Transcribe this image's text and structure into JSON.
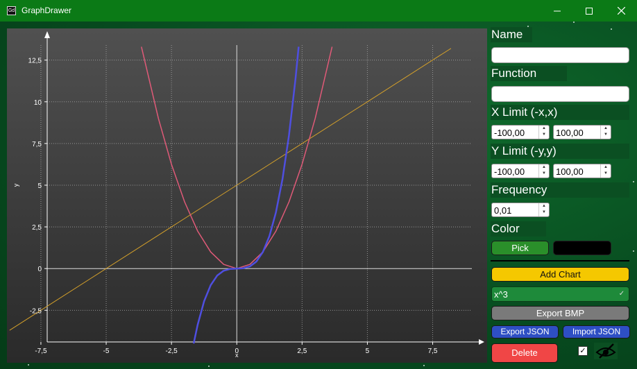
{
  "window": {
    "title": "GraphDrawer",
    "app_icon_text": "Gd"
  },
  "panel": {
    "name_label": "Name",
    "name_value": "",
    "function_label": "Function",
    "function_value": "",
    "xlimit_label": "X Limit (-x,x)",
    "xlimit_min": "-100,00",
    "xlimit_max": "100,00",
    "ylimit_label": "Y Limit (-y,y)",
    "ylimit_min": "-100,00",
    "ylimit_max": "100,00",
    "frequency_label": "Frequency",
    "frequency_value": "0,01",
    "color_label": "Color",
    "pick_label": "Pick",
    "color_swatch": "#000000",
    "add_chart_label": "Add Chart",
    "selected_chart": "x^3",
    "export_bmp_label": "Export BMP",
    "export_json_label": "Export JSON",
    "import_json_label": "Import JSON",
    "delete_label": "Delete",
    "visible_checked": true
  },
  "colors": {
    "titlebar": "#0b7a16",
    "add_chart": "#f5c800",
    "pick": "#2a8f2a",
    "export_bmp": "#7a7a7a",
    "json_buttons": "#2e4fc4",
    "delete": "#f04646"
  },
  "chart_data": {
    "type": "line",
    "xlabel": "x",
    "ylabel": "y",
    "xlim": [
      -8.8,
      9.0
    ],
    "ylim": [
      -4.4,
      13.4
    ],
    "x_ticks": [
      "-7,5",
      "-5",
      "-2,5",
      "0",
      "2,5",
      "5",
      "7,5"
    ],
    "y_ticks": [
      "-2,5",
      "0",
      "2,5",
      "5",
      "7,5",
      "10",
      "12,5"
    ],
    "grid": true,
    "series": [
      {
        "formula": "x+5",
        "color": "#d4a02a",
        "width": 1,
        "x": [
          -8.7,
          -7.5,
          -5,
          -2.5,
          0,
          2.5,
          5,
          7.5,
          8.2
        ],
        "y": [
          -3.7,
          -2.5,
          0,
          2.5,
          5,
          7.5,
          10,
          12.5,
          13.2
        ]
      },
      {
        "formula": "x^2",
        "color": "#e05a78",
        "width": 1.5,
        "x": [
          -3.65,
          -3.0,
          -2.5,
          -2.0,
          -1.5,
          -1.0,
          -0.5,
          0,
          0.5,
          1.0,
          1.5,
          2.0,
          2.5,
          3.0,
          3.65
        ],
        "y": [
          13.3,
          9.0,
          6.25,
          4.0,
          2.25,
          1.0,
          0.25,
          0,
          0.25,
          1.0,
          2.25,
          4.0,
          6.25,
          9.0,
          13.3
        ]
      },
      {
        "formula": "x^3",
        "color": "#4f4fe0",
        "width": 2.5,
        "x": [
          -1.65,
          -1.5,
          -1.25,
          -1.0,
          -0.75,
          -0.5,
          -0.25,
          0,
          0.25,
          0.5,
          0.75,
          1.0,
          1.25,
          1.5,
          1.75,
          2.0,
          2.25,
          2.37
        ],
        "y": [
          -4.49,
          -3.38,
          -1.95,
          -1.0,
          -0.42,
          -0.13,
          -0.02,
          0,
          0.02,
          0.13,
          0.42,
          1.0,
          1.95,
          3.38,
          5.36,
          8.0,
          11.39,
          13.3
        ]
      }
    ]
  }
}
